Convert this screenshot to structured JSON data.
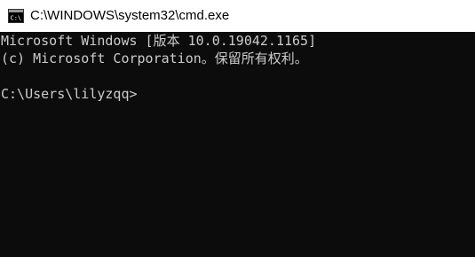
{
  "window": {
    "title": "C:\\WINDOWS\\system32\\cmd.exe",
    "icon": "cmd-icon"
  },
  "console": {
    "lines": [
      "Microsoft Windows [版本 10.0.19042.1165]",
      "(c) Microsoft Corporation。保留所有权利。",
      "",
      "C:\\Users\\lilyzqq>"
    ]
  },
  "colors": {
    "console_bg": "#0c0c0c",
    "console_text": "#cccccc",
    "titlebar_bg": "#ffffff"
  }
}
